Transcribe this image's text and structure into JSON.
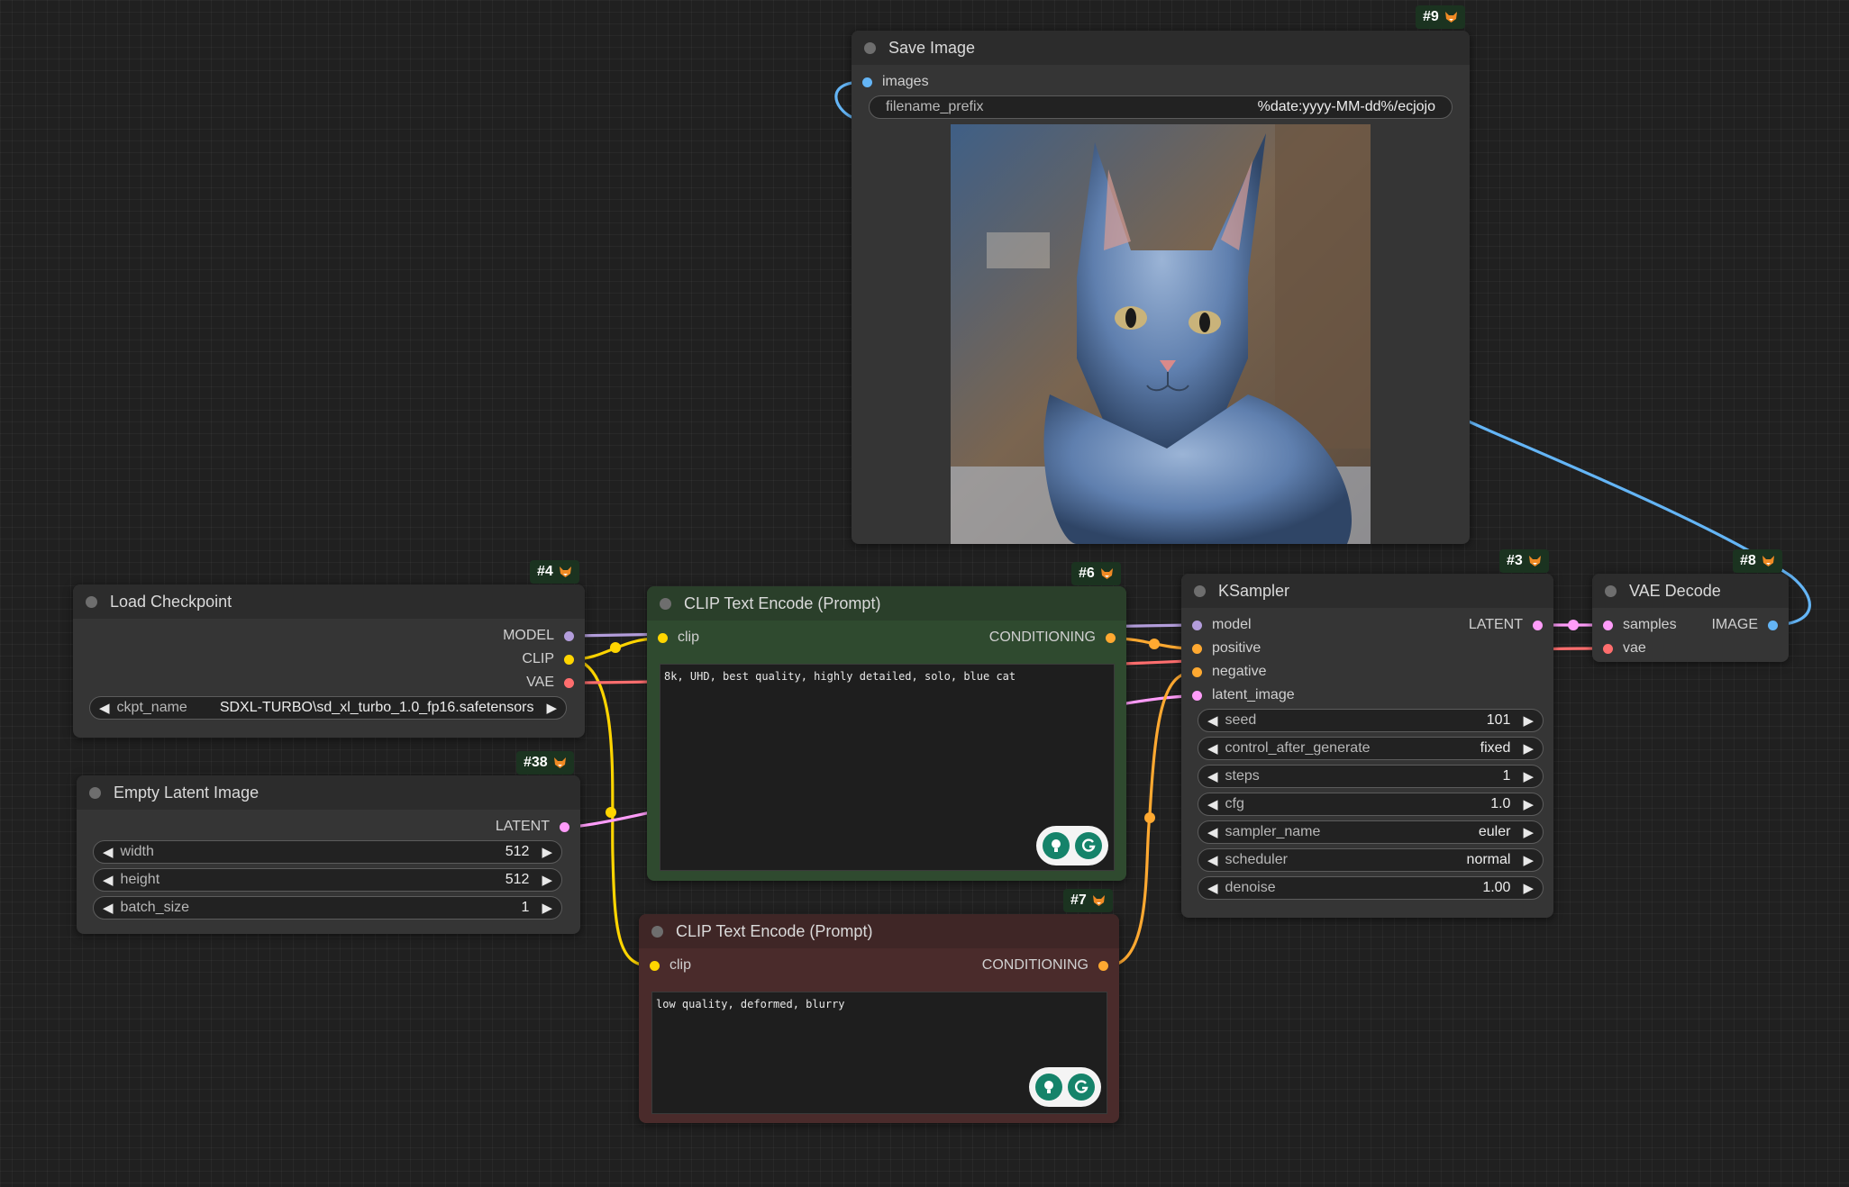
{
  "colors": {
    "clip": "#ffd500",
    "conditioning": "#ffa931",
    "model": "#b39ddb",
    "latent": "#ff9cf9",
    "vae": "#ff6e6e",
    "image": "#64b5f6",
    "positive_panel": "#2f4a2f",
    "negative_panel": "#4a2b2b"
  },
  "nodes": {
    "save_image": {
      "badge": "#9",
      "title": "Save Image",
      "input_images": "images",
      "prefix_label": "filename_prefix",
      "prefix_value": "%date:yyyy-MM-dd%/ecjojo",
      "preview_subject": "blue cat portrait"
    },
    "load_checkpoint": {
      "badge": "#4",
      "title": "Load Checkpoint",
      "out_model": "MODEL",
      "out_clip": "CLIP",
      "out_vae": "VAE",
      "ckpt_label": "ckpt_name",
      "ckpt_value": "SDXL-TURBO\\sd_xl_turbo_1.0_fp16.safetensors"
    },
    "empty_latent": {
      "badge": "#38",
      "title": "Empty Latent Image",
      "out_latent": "LATENT",
      "width_label": "width",
      "width_value": "512",
      "height_label": "height",
      "height_value": "512",
      "batch_label": "batch_size",
      "batch_value": "1"
    },
    "clip_positive": {
      "badge": "#6",
      "title": "CLIP Text Encode (Prompt)",
      "in_clip": "clip",
      "out_conditioning": "CONDITIONING",
      "text": "8k, UHD, best quality, highly detailed, solo, blue cat"
    },
    "clip_negative": {
      "badge": "#7",
      "title": "CLIP Text Encode (Prompt)",
      "in_clip": "clip",
      "out_conditioning": "CONDITIONING",
      "text": "low quality, deformed, blurry"
    },
    "ksampler": {
      "badge": "#3",
      "title": "KSampler",
      "in_model": "model",
      "in_positive": "positive",
      "in_negative": "negative",
      "in_latent": "latent_image",
      "out_latent": "LATENT",
      "seed_label": "seed",
      "seed_value": "101",
      "cag_label": "control_after_generate",
      "cag_value": "fixed",
      "steps_label": "steps",
      "steps_value": "1",
      "cfg_label": "cfg",
      "cfg_value": "1.0",
      "sampler_label": "sampler_name",
      "sampler_value": "euler",
      "scheduler_label": "scheduler",
      "scheduler_value": "normal",
      "denoise_label": "denoise",
      "denoise_value": "1.00"
    },
    "vae_decode": {
      "badge": "#8",
      "title": "VAE Decode",
      "in_samples": "samples",
      "in_vae": "vae",
      "out_image": "IMAGE"
    }
  },
  "icons": {
    "badge": "fox-icon",
    "assist_left": "lightbulb-icon",
    "assist_right": "grammarly-icon",
    "arrow_left": "arrow-left-icon",
    "arrow_right": "arrow-right-icon"
  }
}
